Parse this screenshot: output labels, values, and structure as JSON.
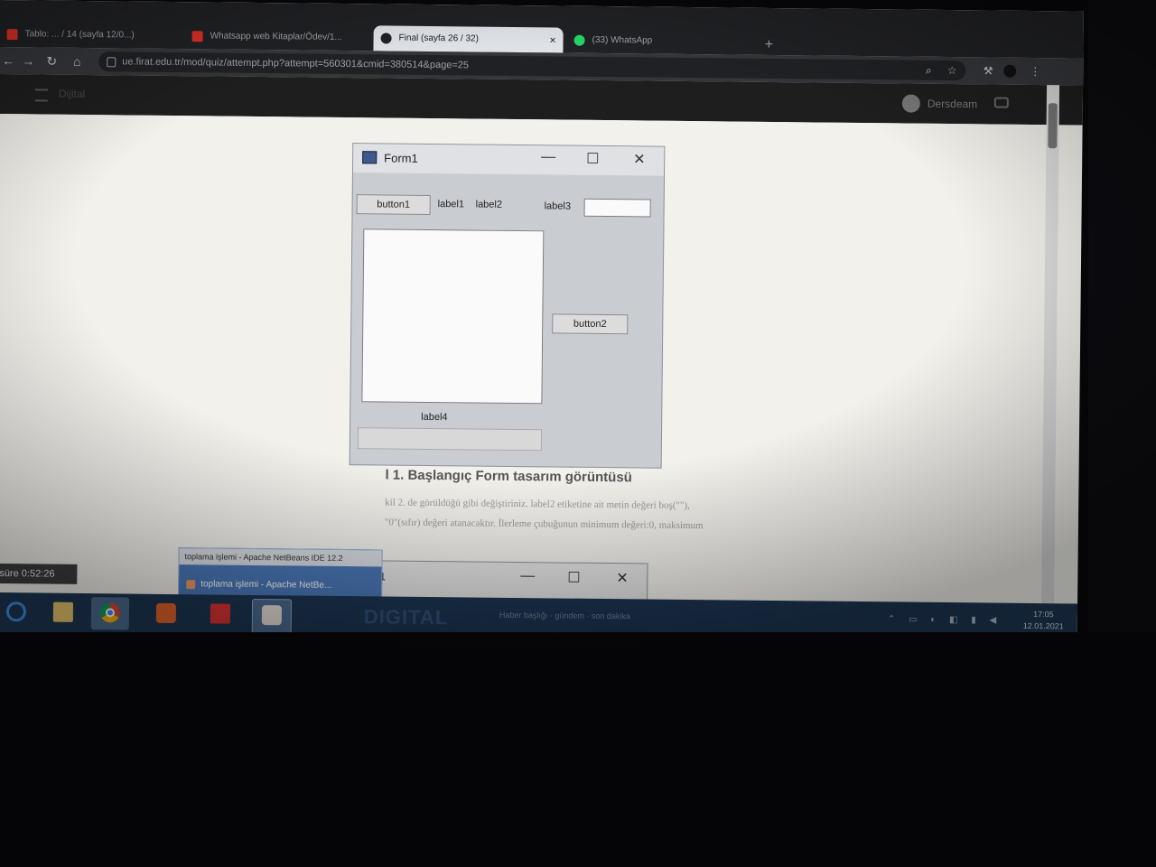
{
  "browser": {
    "tabs": [
      {
        "label": "Tablo: ... / 14 (sayfa 12/0...)",
        "favicon_color": "#d93025"
      },
      {
        "label": "Whatsapp web Kitaplar/Ödev/1...",
        "favicon_color": "#d93025"
      },
      {
        "label": "Final (sayfa 26 / 32)",
        "favicon_color": "#202124"
      },
      {
        "label": "(33) WhatsApp",
        "favicon_color": "#25d366"
      }
    ],
    "active_tab_close": "×",
    "new_tab": "+",
    "url": "ue.firat.edu.tr/mod/quiz/attempt.php?attempt=560301&cmid=380514&page=25"
  },
  "site": {
    "title": "Dijital",
    "user_name": "Dersdeam"
  },
  "form1": {
    "title": "Form1",
    "minimize": "—",
    "maximize": "☐",
    "close": "✕",
    "button1": "button1",
    "label1": "label1",
    "label2": "label2",
    "label3": "label3",
    "button2": "button2",
    "label4": "label4"
  },
  "content": {
    "caption": "l 1. Başlangıç Form tasarım görüntüsü",
    "line1": "kil 2. de görüldüğü gibi değiştiriniz. label2 etiketine ait metin değeri  boş(\"\"),",
    "line2": "\"0\"(sıfır) değeri atanacaktır. İlerleme çubuğunun minimum değeri:0, maksimum"
  },
  "form1_second": {
    "title": "1",
    "minimize": "—",
    "maximize": "☐",
    "close": "✕"
  },
  "timer": "süre 0:52:26",
  "netbeans_popup": {
    "title": "toplama işlemi - Apache NetBeans IDE 12.2",
    "label": "toplama işlemi - Apache NetBe..."
  },
  "taskbar": {
    "digital": "DIGITAL",
    "news": "Haber başlığı · gündem · son dakika",
    "clock_time": "17:05",
    "clock_date": "12.01.2021",
    "tray": "⌃ ▭ ◐ ◧ ▮ ◀"
  },
  "colors": {
    "accent": "#4285f4",
    "taskbar": "#1d3552",
    "page_bg": "#f2f1ec"
  }
}
